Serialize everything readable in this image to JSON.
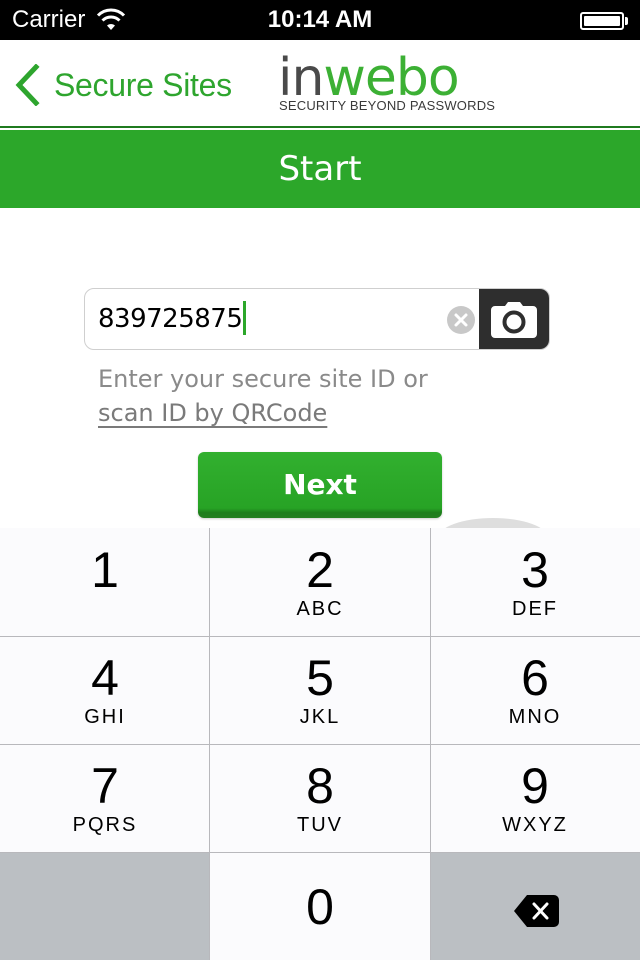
{
  "status_bar": {
    "carrier": "Carrier",
    "time": "10:14 AM",
    "wifi_icon": "wifi-icon",
    "battery_icon": "battery-full-icon"
  },
  "nav": {
    "back_label": "Secure Sites",
    "back_icon": "chevron-left-icon",
    "logo": {
      "word_part1": "in",
      "word_part2": "webo",
      "tagline": "SECURITY BEYOND PASSWORDS"
    }
  },
  "banner": {
    "title": "Start"
  },
  "form": {
    "site_id_value": "839725875",
    "clear_icon": "clear-circle-icon",
    "camera_icon": "camera-icon",
    "hint_text": "Enter your secure site ID or",
    "scan_link": "scan ID by QRCode",
    "next_label": "Next"
  },
  "colors": {
    "brand_green": "#2ca72a",
    "link_green": "#2ea52e",
    "keypad_dark": "#bbbfc3"
  },
  "keypad": {
    "keys": [
      {
        "digit": "1",
        "letters": ""
      },
      {
        "digit": "2",
        "letters": "ABC"
      },
      {
        "digit": "3",
        "letters": "DEF"
      },
      {
        "digit": "4",
        "letters": "GHI"
      },
      {
        "digit": "5",
        "letters": "JKL"
      },
      {
        "digit": "6",
        "letters": "MNO"
      },
      {
        "digit": "7",
        "letters": "PQRS"
      },
      {
        "digit": "8",
        "letters": "TUV"
      },
      {
        "digit": "9",
        "letters": "WXYZ"
      },
      {
        "digit": "0",
        "letters": ""
      }
    ],
    "backspace_icon": "backspace-icon"
  }
}
